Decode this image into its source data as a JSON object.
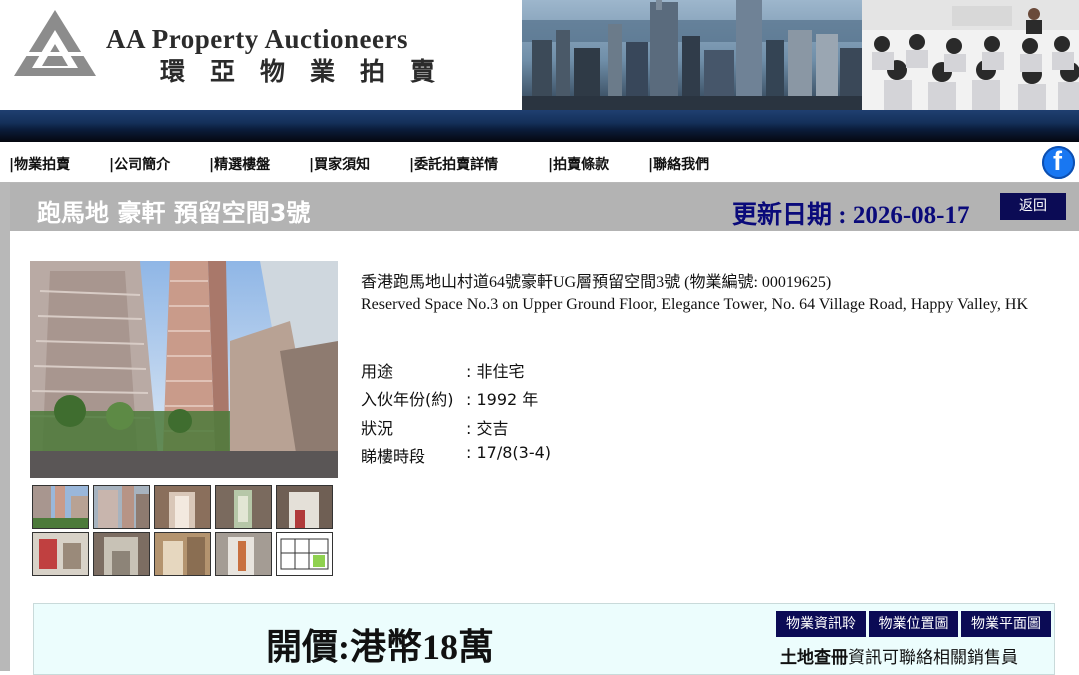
{
  "header": {
    "company_en": "AA Property Auctioneers",
    "company_zh": "環亞物業拍賣"
  },
  "nav": {
    "items": [
      "物業拍賣",
      "公司簡介",
      "精選樓盤",
      "買家須知",
      "委託拍賣詳情",
      "拍賣條款",
      "聯絡我們"
    ],
    "separator": "|"
  },
  "social": {
    "facebook_glyph": "f",
    "icon": "facebook-icon"
  },
  "listing": {
    "title": "跑馬地 豪軒 預留空間3號",
    "update_label": "更新日期 : ",
    "update_date": "2026-08-17",
    "back_label": "返回",
    "address_zh": "香港跑馬地山村道64號豪軒UG層預留空間3號 (物業編號: 00019625)",
    "address_en": "Reserved Space No.3 on Upper Ground Floor, Elegance Tower, No. 64 Village Road, Happy Valley, HK",
    "details": [
      {
        "label": "用途",
        "value": "非住宅"
      },
      {
        "label": "入伙年份(約)",
        "value": "1992 年"
      },
      {
        "label": "狀況",
        "value": "交吉"
      },
      {
        "label": "睇樓時段",
        "value": "17/8(3-4)"
      }
    ],
    "separator": ":",
    "price": "開價:港幣18萬",
    "info_buttons": [
      "物業資訊聆",
      "物業位置圖",
      "物業平面圖"
    ],
    "land_note_bold": "土地查冊",
    "land_note_rest": "資訊可聯絡相關銷售員"
  },
  "colors": {
    "navy": "#0b0b55",
    "date_blue": "#0a0a7a",
    "frame_grey": "#b8b8b8",
    "price_bg": "#ecfdfd",
    "facebook": "#1877f2"
  }
}
